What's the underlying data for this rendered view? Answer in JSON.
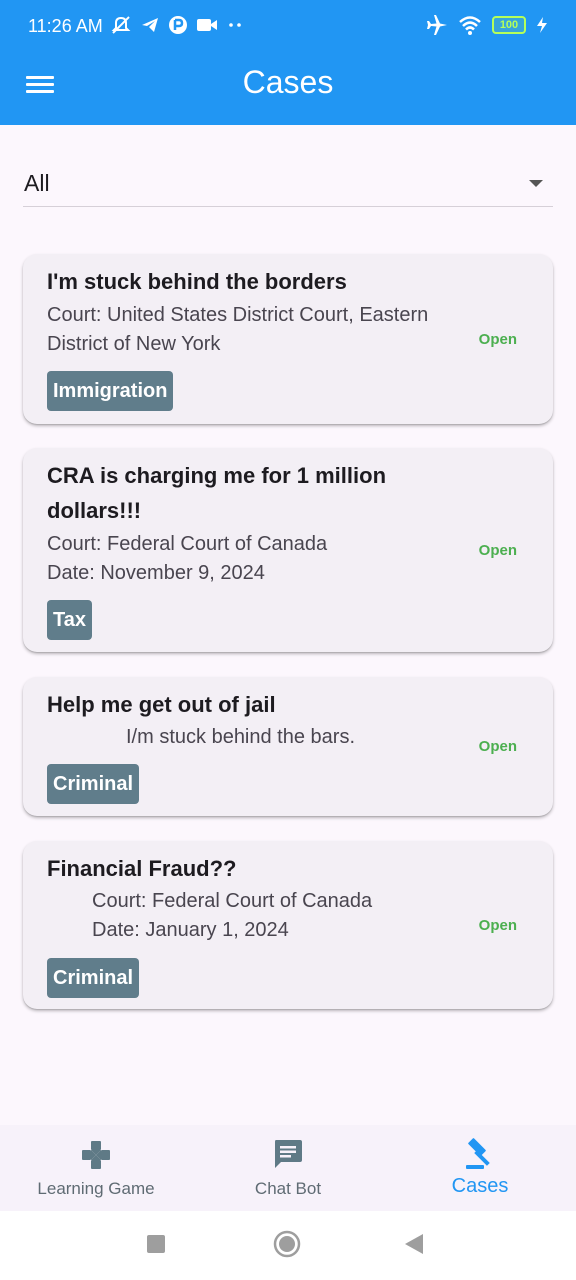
{
  "status_bar": {
    "time": "11:26 AM",
    "battery": "100",
    "icons": [
      "mute-icon",
      "telegram-icon",
      "app-icon",
      "video-icon",
      "more-icon",
      "airplane-icon",
      "wifi-icon",
      "battery-icon",
      "charging-icon"
    ]
  },
  "app_bar": {
    "title": "Cases"
  },
  "filter": {
    "value": "All"
  },
  "cases": [
    {
      "title": "I'm stuck behind the borders",
      "line1": "Court: United States District Court, Eastern",
      "line2": "District of New York",
      "status": "Open",
      "tag": "Immigration"
    },
    {
      "title": "CRA is charging me for 1 million dollars!!!",
      "line1": "Court: Federal Court of Canada",
      "line2": "Date: November 9, 2024",
      "status": "Open",
      "tag": "Tax"
    },
    {
      "title": "Help me get out of jail",
      "line1": "I/m stuck behind the bars.",
      "status": "Open",
      "tag": "Criminal"
    },
    {
      "title": "Financial Fraud??",
      "line1": "Court: Federal Court of Canada",
      "line2": "Date: January 1, 2024",
      "status": "Open",
      "tag": "Criminal"
    }
  ],
  "bottom_nav": {
    "items": [
      {
        "label": "Learning Game",
        "icon": "gamepad-icon"
      },
      {
        "label": "Chat Bot",
        "icon": "chat-icon"
      },
      {
        "label": "Cases",
        "icon": "gavel-icon",
        "active": true
      }
    ]
  },
  "colors": {
    "primary": "#2196f3",
    "status_open": "#4caf50",
    "tag_bg": "#607d8b"
  }
}
